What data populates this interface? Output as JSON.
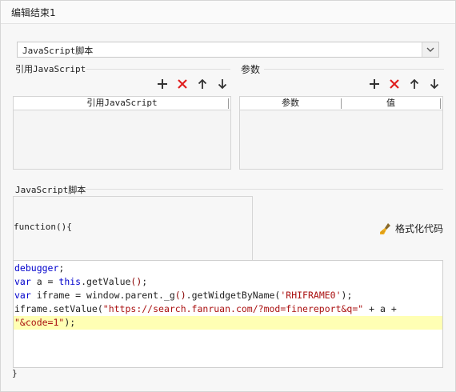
{
  "window": {
    "title": "编辑结束1"
  },
  "script_type_select": {
    "value": "JavaScript脚本"
  },
  "ref_section": {
    "title": "引用JavaScript",
    "column": "引用JavaScript"
  },
  "params_section": {
    "title": "参数",
    "columns": [
      "参数",
      "值"
    ]
  },
  "toolbar_icons": [
    "plus-icon",
    "delete-x-icon",
    "arrow-up-icon",
    "arrow-down-icon"
  ],
  "script_section": {
    "title": "JavaScript脚本",
    "function_header": "function(){",
    "format_button": "格式化代码",
    "closing": "}",
    "code_lines": [
      [
        {
          "t": "debugger",
          "c": "kw"
        },
        {
          "t": ";",
          "c": ""
        }
      ],
      [
        {
          "t": "var",
          "c": "kw"
        },
        {
          "t": " a = ",
          "c": ""
        },
        {
          "t": "this",
          "c": "kw"
        },
        {
          "t": ".getValue",
          "c": ""
        },
        {
          "t": "()",
          "c": "fn"
        },
        {
          "t": ";",
          "c": ""
        }
      ],
      [
        {
          "t": "var",
          "c": "kw"
        },
        {
          "t": " iframe = window.parent._g",
          "c": ""
        },
        {
          "t": "()",
          "c": "fn"
        },
        {
          "t": ".getWidgetByName(",
          "c": ""
        },
        {
          "t": "'RHIFRAME0'",
          "c": "str"
        },
        {
          "t": ");",
          "c": ""
        }
      ],
      [
        {
          "t": "iframe.setValue(",
          "c": ""
        },
        {
          "t": "\"https://search.fanruan.com/?mod=finereport&q=\"",
          "c": "str"
        },
        {
          "t": " + a + ",
          "c": ""
        }
      ],
      [
        {
          "t": "\"&code=1\"",
          "c": "str"
        },
        {
          "t": ");",
          "c": ""
        }
      ]
    ],
    "highlighted_line": 4
  },
  "colors": {
    "delete": "#e02020",
    "keyword": "#0000cc",
    "string": "#aa1111",
    "highlight": "#ffffb4"
  }
}
